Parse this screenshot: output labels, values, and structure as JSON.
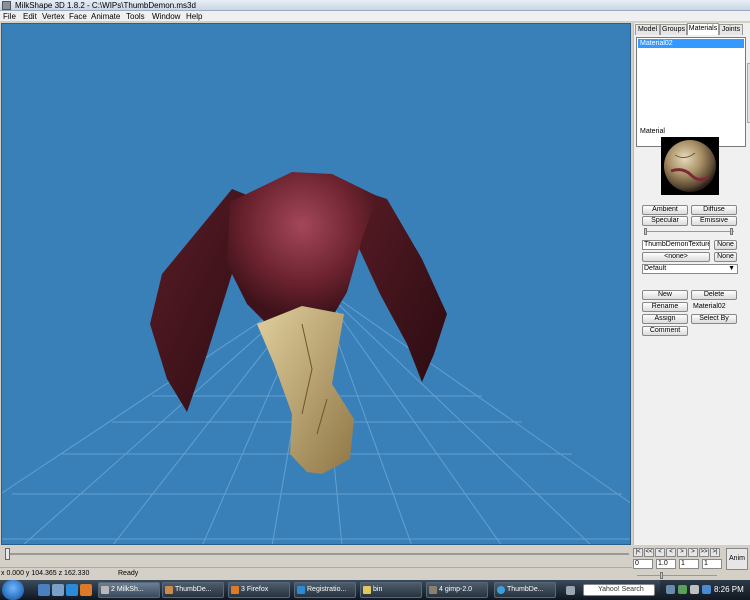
{
  "window": {
    "title": "MilkShape 3D 1.8.2 - C:\\WIPs\\ThumbDemon.ms3d"
  },
  "menu": [
    "File",
    "Edit",
    "Vertex",
    "Face",
    "Animate",
    "Tools",
    "Window",
    "Help"
  ],
  "colors": {
    "viewport_bg": "#3a80b8",
    "grid": "#6aa6d6",
    "selection": "#3399ff"
  },
  "panel": {
    "tabs": [
      "Model",
      "Groups",
      "Materials",
      "Joints"
    ],
    "active_tab": "Materials",
    "materials": [
      "Material02"
    ],
    "material_label": "Material",
    "buttons": {
      "ambient": "Ambient",
      "diffuse": "Diffuse",
      "specular": "Specular",
      "emissive": "Emissive",
      "none1": "None",
      "none2": "None",
      "new": "New",
      "delete": "Delete",
      "rename": "Rename",
      "assign": "Assign",
      "select_by": "Select By",
      "comment": "Comment"
    },
    "texture1": "ThumbDemonTexture.tga",
    "texture2": "<none>",
    "mode": "Default",
    "name_value": "Material02"
  },
  "animation": {
    "start_frame": "0",
    "speed": "1.0",
    "frame": "1",
    "end_frame": "1",
    "anim_button": "Anim",
    "controls": [
      "|<",
      "<<",
      "<",
      "<",
      ">",
      ">",
      ">>",
      ">|"
    ]
  },
  "status": {
    "coords": "x 0.000 y 104.365 z 162.330",
    "message": "Ready"
  },
  "taskbar": {
    "items": [
      "2 MilkSh...",
      "ThumbDe...",
      "3 Firefox",
      "Registratio...",
      "bin",
      "4 gimp-2.0",
      "ThumbDe..."
    ],
    "search_placeholder": "Yahoo! Search",
    "clock": "8:26 PM"
  }
}
